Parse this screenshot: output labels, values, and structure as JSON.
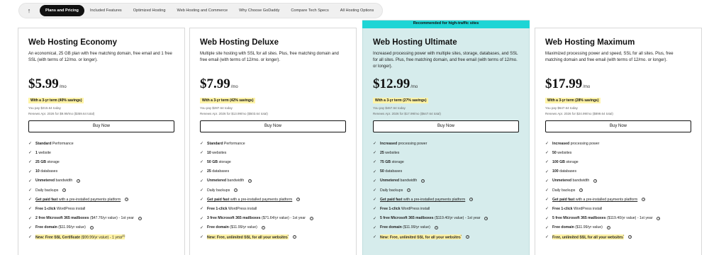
{
  "nav": {
    "up_icon": "arrow-up-icon",
    "items": [
      {
        "label": "Plans and Pricing",
        "active": true
      },
      {
        "label": "Included Features",
        "active": false
      },
      {
        "label": "Optimized Hosting",
        "active": false
      },
      {
        "label": "Web Hosting and Commerce",
        "active": false
      },
      {
        "label": "Why Choose GoDaddy",
        "active": false
      },
      {
        "label": "Compare Tech Specs",
        "active": false
      },
      {
        "label": "All Hosting Options",
        "active": false
      }
    ]
  },
  "colors": {
    "highlight_bg": "#d6ecec",
    "banner": "#1ed5d5",
    "badge": "#fff3a6"
  },
  "cards": [
    {
      "title": "Web Hosting Economy",
      "desc": "An economical, 25 GB plan with free matching domain, free email and 1 free SSL (with terms of 12/mo. or longer).",
      "price": "$5.99",
      "per": "/mo",
      "term": "With a 3-yr term (40% savings)",
      "pay": "You pay $215.64 today",
      "renew": "Renews Apr. 2026 for $9.99/mo ($359.64 total)",
      "buy": "Buy Now",
      "features": [
        {
          "bold": "Standard",
          "rest": " Performance",
          "info": false
        },
        {
          "bold": "1",
          "rest": " website",
          "info": false
        },
        {
          "bold": "25 GB",
          "rest": " storage",
          "info": false
        },
        {
          "bold": "10",
          "rest": " databases",
          "info": false
        },
        {
          "bold": "Unmetered",
          "rest": " bandwidth",
          "info": true
        },
        {
          "bold": "",
          "rest": "Daily backups",
          "info": true
        },
        {
          "bold": "Get paid fast",
          "rest": " with a pre-installed payments platform",
          "info": true,
          "underline": true
        },
        {
          "bold": "Free 1-click",
          "rest": " WordPress install",
          "info": false
        },
        {
          "bold": "2 free Microsoft 365 mailboxes",
          "rest": " ($47.76/yr value) - 1st year",
          "info": true
        },
        {
          "bold": "Free domain",
          "rest": " ($11.99/yr value)",
          "info": true
        },
        {
          "bold": "New: Free SSL Certificate",
          "rest": " ($99.99/yr value) - 1 year",
          "sup": "[1]",
          "info": false,
          "highlight": true
        }
      ]
    },
    {
      "title": "Web Hosting Deluxe",
      "desc": "Multiple site hosting with SSL for all sites. Plus, free matching domain and free email (with terms of 12/mo. or longer).",
      "price": "$7.99",
      "per": "/mo",
      "term": "With a 3-yr term (42% savings)",
      "pay": "You pay $287.64 today",
      "renew": "Renews Apr. 2026 for $13.99/mo ($503.64 total)",
      "buy": "Buy Now",
      "features": [
        {
          "bold": "Standard",
          "rest": " Performance",
          "info": false
        },
        {
          "bold": "10",
          "rest": " websites",
          "info": false
        },
        {
          "bold": "50 GB",
          "rest": " storage",
          "info": false
        },
        {
          "bold": "25",
          "rest": " databases",
          "info": false
        },
        {
          "bold": "Unmetered",
          "rest": " bandwidth",
          "info": true
        },
        {
          "bold": "",
          "rest": "Daily backups",
          "info": true
        },
        {
          "bold": "Get paid fast",
          "rest": " with a pre-installed payments platform",
          "info": true,
          "underline": true
        },
        {
          "bold": "Free 1-click",
          "rest": " WordPress install",
          "info": false
        },
        {
          "bold": "3 free Microsoft 365 mailboxes",
          "rest": " ($71.64/yr value) - 1st year",
          "info": true
        },
        {
          "bold": "Free domain",
          "rest": " ($11.99/yr value)",
          "info": true
        },
        {
          "bold": "New: Free, unlimited SSL for all your websites",
          "rest": "",
          "sup": "*",
          "info": true,
          "highlight": true
        }
      ]
    },
    {
      "title": "Web Hosting Ultimate",
      "banner": "Recommended for high-traffic sites",
      "desc": "Increased processing power with multiple sites, storage, databases, and SSL for all sites. Plus, free matching domain, and free email (with terms of 12/mo. or longer).",
      "price": "$12.99",
      "per": "/mo",
      "term": "With a 3-yr term (27% savings)",
      "pay": "You pay $467.64 today",
      "renew": "Renews Apr. 2026 for $17.99/mo ($647.64 total)",
      "buy": "Buy Now",
      "features": [
        {
          "bold": "Increased",
          "rest": " processing power",
          "info": false
        },
        {
          "bold": "25",
          "rest": " websites",
          "info": false
        },
        {
          "bold": "75 GB",
          "rest": " storage",
          "info": false
        },
        {
          "bold": "50",
          "rest": " databases",
          "info": false
        },
        {
          "bold": "Unmetered",
          "rest": " bandwidth",
          "info": true
        },
        {
          "bold": "",
          "rest": "Daily backups",
          "info": true
        },
        {
          "bold": "Get paid fast",
          "rest": " with a pre-installed payments platform",
          "info": true,
          "underline": true
        },
        {
          "bold": "Free 1-click",
          "rest": " WordPress install",
          "info": false
        },
        {
          "bold": "5 free Microsoft 365 mailboxes",
          "rest": " ($119.40/yr value) - 1st year",
          "info": true
        },
        {
          "bold": "Free domain",
          "rest": " ($11.99/yr value)",
          "info": true
        },
        {
          "bold": "New: Free, unlimited SSL for all your websites",
          "rest": "",
          "sup": "*",
          "info": true,
          "highlight": true
        }
      ]
    },
    {
      "title": "Web Hosting Maximum",
      "desc": "Maximized processing power and speed, SSL for all sites. Plus, free matching domain and free email (with terms of 12/mo. or longer).",
      "price": "$17.99",
      "per": "/mo",
      "term": "With a 3-yr term (28% savings)",
      "pay": "You pay $647.64 today",
      "renew": "Renews Apr. 2026 for $24.99/mo ($899.64 total)",
      "buy": "Buy Now",
      "features": [
        {
          "bold": "Increased",
          "rest": " processing power",
          "info": false
        },
        {
          "bold": "50",
          "rest": " websites",
          "info": false
        },
        {
          "bold": "100 GB",
          "rest": " storage",
          "info": false
        },
        {
          "bold": "100",
          "rest": " databases",
          "info": false
        },
        {
          "bold": "Unmetered",
          "rest": " bandwidth",
          "info": true
        },
        {
          "bold": "",
          "rest": "Daily backups",
          "info": true
        },
        {
          "bold": "Get paid fast",
          "rest": " with a pre-installed payments platform",
          "info": true,
          "underline": true
        },
        {
          "bold": "Free 1-click",
          "rest": " WordPress install",
          "info": false
        },
        {
          "bold": "5 free Microsoft 365 mailboxes",
          "rest": " ($119.40/yr value) - 1st year",
          "info": true
        },
        {
          "bold": "Free domain",
          "rest": " ($11.99/yr value)",
          "info": true
        },
        {
          "bold": "Free, unlimited SSL for all your websites",
          "rest": "",
          "sup": "*",
          "info": true,
          "highlight": true
        }
      ]
    }
  ]
}
